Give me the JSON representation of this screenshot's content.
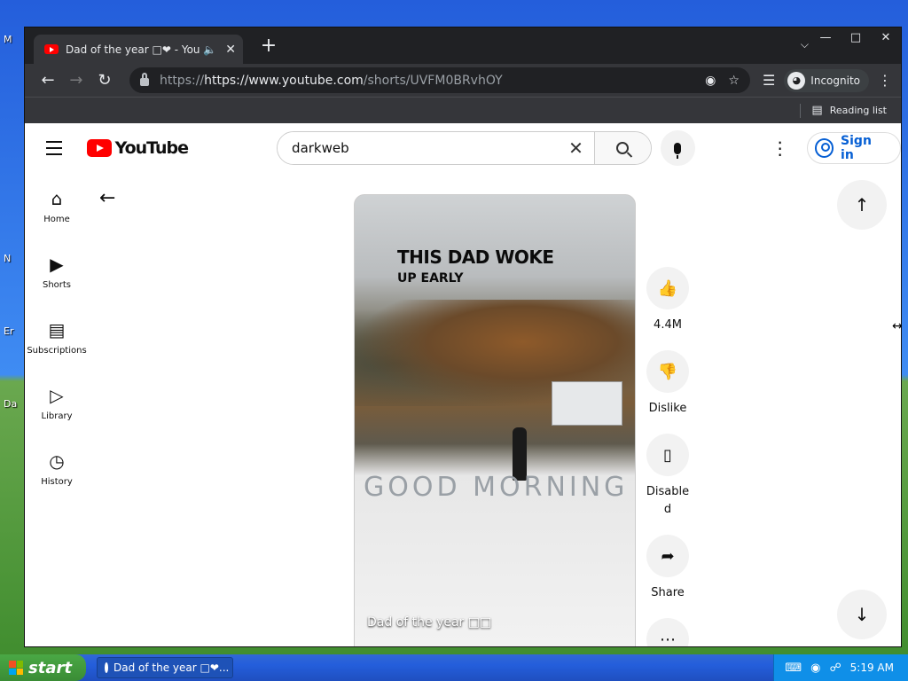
{
  "desktop": {
    "icons": [
      "M",
      "N",
      "Er",
      "Da"
    ]
  },
  "browser": {
    "tab": {
      "title": "Dad of the year □❤ - YouTube",
      "audio_icon": "speaker-icon",
      "close": "✕"
    },
    "new_tab": "+",
    "window_buttons": [
      "—",
      "□",
      "✕"
    ],
    "url_host": "https://www.youtube.com",
    "url_path": "/shorts/UVFM0BRvhOY",
    "incognito_label": "Incognito",
    "reading_list_label": "Reading list"
  },
  "youtube": {
    "logo_text": "YouTube",
    "search": {
      "value": "darkweb",
      "placeholder": "Search"
    },
    "sign_in_label": "Sign in",
    "miniguide": [
      {
        "label": "Home",
        "icon": "home-icon"
      },
      {
        "label": "Shorts",
        "icon": "shorts-icon"
      },
      {
        "label": "Subscriptions",
        "icon": "subscriptions-icon"
      },
      {
        "label": "Library",
        "icon": "library-icon"
      },
      {
        "label": "History",
        "icon": "history-icon"
      }
    ],
    "short": {
      "overlay_line1": "THIS DAD WOKE",
      "overlay_line2": "UP EARLY",
      "snow_text": "GOOD MORNING",
      "title": "Dad of the year □□"
    },
    "actions": {
      "like_count": "4.4M",
      "dislike_label": "Dislike",
      "comments_label": "Disable d",
      "share_label": "Share"
    }
  },
  "taskbar": {
    "start_label": "start",
    "task_title": "Dad of the year □❤...",
    "clock": "5:19 AM"
  }
}
